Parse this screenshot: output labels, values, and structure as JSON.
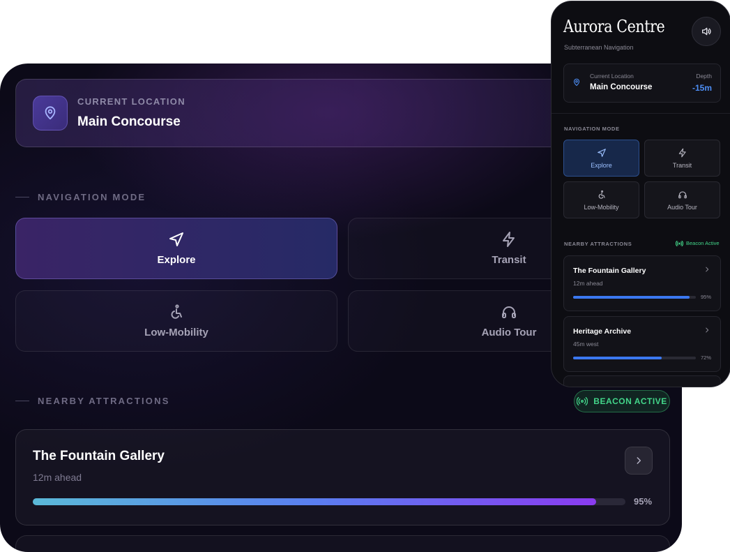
{
  "main": {
    "location": {
      "label": "CURRENT LOCATION",
      "name": "Main Concourse"
    },
    "nav_section": "NAVIGATION MODE",
    "modes": [
      {
        "label": "Explore",
        "icon": "navigation-arrow-icon",
        "active": true
      },
      {
        "label": "Transit",
        "icon": "lightning-icon",
        "active": false
      },
      {
        "label": "Low-Mobility",
        "icon": "accessibility-icon",
        "active": false
      },
      {
        "label": "Audio Tour",
        "icon": "headphones-icon",
        "active": false
      }
    ],
    "attractions_section": "NEARBY ATTRACTIONS",
    "beacon": "BEACON ACTIVE",
    "attractions": [
      {
        "name": "The Fountain Gallery",
        "distance": "12m ahead",
        "percent": "95%",
        "progress": 0.95
      }
    ]
  },
  "phone": {
    "title": "Aurora Centre",
    "subtitle": "Subterranean Navigation",
    "location": {
      "label": "Current Location",
      "name": "Main Concourse",
      "depth_label": "Depth",
      "depth_value": "-15m"
    },
    "nav_section": "NAVIGATION MODE",
    "modes": [
      {
        "label": "Explore",
        "active": true
      },
      {
        "label": "Transit",
        "active": false
      },
      {
        "label": "Low-Mobility",
        "active": false
      },
      {
        "label": "Audio Tour",
        "active": false
      }
    ],
    "attractions_section": "NEARBY ATTRACTIONS",
    "beacon": "Beacon Active",
    "attractions": [
      {
        "name": "The Fountain Gallery",
        "distance": "12m ahead",
        "percent": "95%",
        "progress": 0.95
      },
      {
        "name": "Heritage Archive",
        "distance": "45m west",
        "percent": "72%",
        "progress": 0.72
      }
    ]
  },
  "colors": {
    "accent_blue": "#4d8ef5",
    "beacon_green": "#43d68a",
    "progress_start": "#5bb9d8",
    "progress_end": "#8a3bf0"
  }
}
